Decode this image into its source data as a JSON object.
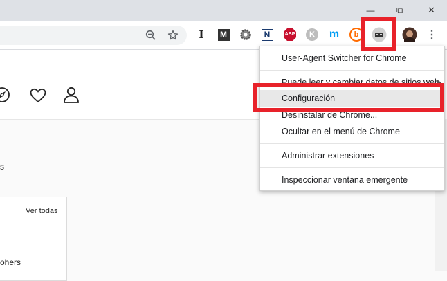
{
  "window": {
    "minimize_glyph": "—",
    "restore_glyph": "⧉",
    "close_glyph": "✕"
  },
  "toolbar": {
    "zoom_icon": "zoom-out-icon",
    "bookmark_icon": "star-icon",
    "extensions": {
      "instapaper": "I",
      "medium": "M",
      "n_extension": "N",
      "adblock": "ABP",
      "k_extension": "K",
      "movistar": "m",
      "b_extension": "b"
    },
    "menu_glyph": "⋮"
  },
  "page": {
    "partial_text": "s",
    "card_link": "Ver todas",
    "card_partial_text": "ohers"
  },
  "context_menu": {
    "items": [
      {
        "label": "User-Agent Switcher for Chrome"
      },
      {
        "label": "Puede leer y cambiar datos de sitios web"
      },
      {
        "label": "Configuración"
      },
      {
        "label": "Desinstalar de Chrome..."
      },
      {
        "label": "Ocultar en el menú de Chrome"
      },
      {
        "label": "Administrar extensiones"
      },
      {
        "label": "Inspeccionar ventana emergente"
      }
    ]
  },
  "colors": {
    "highlight_red": "#e8222a",
    "menu_hover": "#e8e8e8",
    "adblock_red": "#c8102e",
    "movistar_blue": "#019df4",
    "b_orange": "#ff6b00"
  }
}
